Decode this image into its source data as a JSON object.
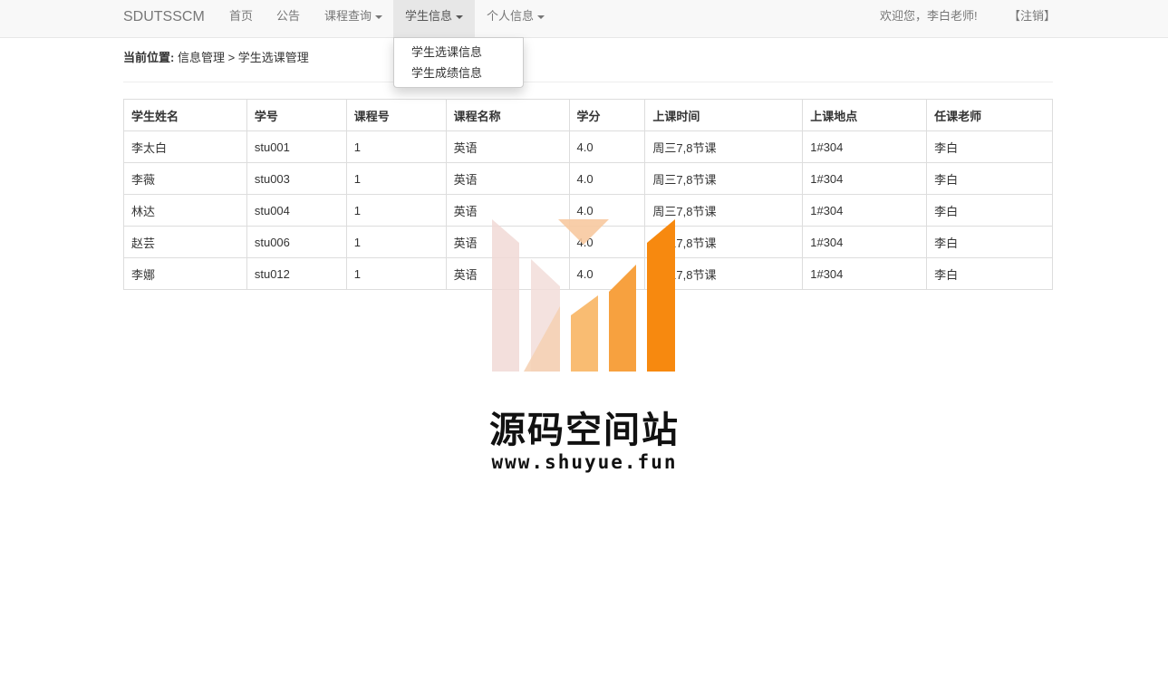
{
  "navbar": {
    "brand": "SDUTSSCM",
    "items": [
      {
        "label": "首页"
      },
      {
        "label": "公告"
      },
      {
        "label": "课程查询"
      },
      {
        "label": "学生信息"
      },
      {
        "label": "个人信息"
      }
    ],
    "welcome": "欢迎您，李白老师!",
    "logout": "【注销】"
  },
  "dropdown": {
    "items": [
      {
        "label": "学生选课信息"
      },
      {
        "label": "学生成绩信息"
      }
    ]
  },
  "breadcrumb": {
    "label": "当前位置:",
    "path": "信息管理 > 学生选课管理"
  },
  "table": {
    "headers": [
      "学生姓名",
      "学号",
      "课程号",
      "课程名称",
      "学分",
      "上课时间",
      "上课地点",
      "任课老师"
    ],
    "rows": [
      [
        "李太白",
        "stu001",
        "1",
        "英语",
        "4.0",
        "周三7,8节课",
        "1#304",
        "李白"
      ],
      [
        "李薇",
        "stu003",
        "1",
        "英语",
        "4.0",
        "周三7,8节课",
        "1#304",
        "李白"
      ],
      [
        "林达",
        "stu004",
        "1",
        "英语",
        "4.0",
        "周三7,8节课",
        "1#304",
        "李白"
      ],
      [
        "赵芸",
        "stu006",
        "1",
        "英语",
        "4.0",
        "周三7,8节课",
        "1#304",
        "李白"
      ],
      [
        "李娜",
        "stu012",
        "1",
        "英语",
        "4.0",
        "周三7,8节课",
        "1#304",
        "李白"
      ]
    ]
  },
  "watermark": {
    "title": "源码空间站",
    "url": "www.shuyue.fun"
  },
  "colors": {
    "navbar_bg": "#f8f8f8",
    "active_nav_bg": "#e7e7e7",
    "border": "#dddddd",
    "accent_orange": "#f7890f"
  }
}
